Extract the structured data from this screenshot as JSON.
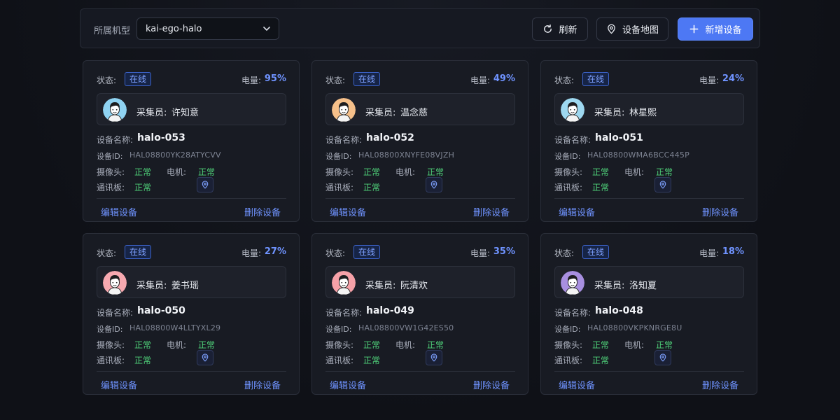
{
  "filter": {
    "model_label": "所属机型",
    "model_value": "kai-ego-halo"
  },
  "toolbar": {
    "refresh_label": "刷新",
    "map_label": "设备地图",
    "add_label": "新增设备"
  },
  "labels": {
    "status": "状态:",
    "battery": "电量:",
    "collector": "采集员:",
    "device_name": "设备名称:",
    "device_id": "设备ID:",
    "camera": "摄像头:",
    "motor": "电机:",
    "comm_board": "通讯板:",
    "edit": "编辑设备",
    "delete": "删除设备"
  },
  "colors": {
    "accent": "#4d78f4",
    "status_ok": "#4fd37a",
    "link": "#6f93ff"
  },
  "devices": [
    {
      "status": "在线",
      "battery": "95%",
      "collector": "许知意",
      "name": "halo-053",
      "id": "HAL08800YK28ATYCVV",
      "camera": "正常",
      "motor": "正常",
      "comm": "正常"
    },
    {
      "status": "在线",
      "battery": "49%",
      "collector": "温念慈",
      "name": "halo-052",
      "id": "HAL08800XNYFE08VJZH",
      "camera": "正常",
      "motor": "正常",
      "comm": "正常"
    },
    {
      "status": "在线",
      "battery": "24%",
      "collector": "林星熙",
      "name": "halo-051",
      "id": "HAL08800WMA6BCC445P",
      "camera": "正常",
      "motor": "正常",
      "comm": "正常"
    },
    {
      "status": "在线",
      "battery": "27%",
      "collector": "姜书瑶",
      "name": "halo-050",
      "id": "HAL08800W4LLTYXL29",
      "camera": "正常",
      "motor": "正常",
      "comm": "正常"
    },
    {
      "status": "在线",
      "battery": "35%",
      "collector": "阮清欢",
      "name": "halo-049",
      "id": "HAL08800VW1G42ES50",
      "camera": "正常",
      "motor": "正常",
      "comm": "正常"
    },
    {
      "status": "在线",
      "battery": "18%",
      "collector": "洛知夏",
      "name": "halo-048",
      "id": "HAL08800VKPKNRGE8U",
      "camera": "正常",
      "motor": "正常",
      "comm": "正常"
    }
  ]
}
